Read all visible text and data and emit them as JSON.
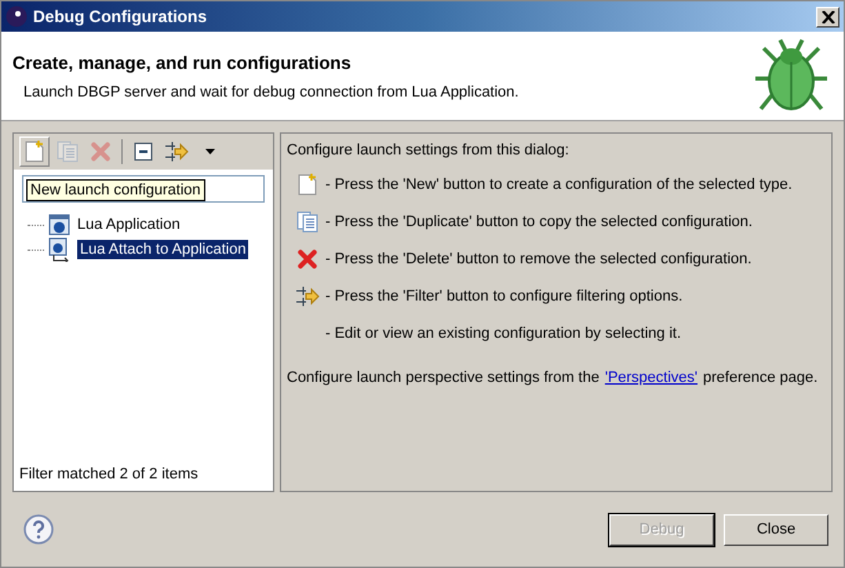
{
  "window": {
    "title": "Debug Configurations"
  },
  "header": {
    "title": "Create, manage, and run configurations",
    "message": "Launch DBGP server and wait for debug connection from Lua Application."
  },
  "toolbar": [
    {
      "kind": "new",
      "disabled": false
    },
    {
      "kind": "duplicate",
      "disabled": true
    },
    {
      "kind": "delete",
      "disabled": true
    },
    {
      "kind": "collapse",
      "disabled": false
    },
    {
      "kind": "filter",
      "disabled": false
    },
    {
      "kind": "menu",
      "disabled": false
    }
  ],
  "tooltip": "New launch configuration",
  "tree": [
    {
      "label": "Lua Application",
      "kind": "app",
      "selected": false
    },
    {
      "label": "Lua Attach to Application",
      "kind": "attach",
      "selected": true
    }
  ],
  "filter_status": "Filter matched 2 of 2 items",
  "info": {
    "intro": "Configure launch settings from this dialog:",
    "items": [
      {
        "kind": "new",
        "text": "- Press the 'New' button to create a configuration of the selected type."
      },
      {
        "kind": "duplicate",
        "text": "- Press the 'Duplicate' button to copy the selected configuration."
      },
      {
        "kind": "delete",
        "text": "- Press the 'Delete' button to remove the selected configuration."
      },
      {
        "kind": "filter",
        "text": "- Press the 'Filter' button to configure filtering options."
      },
      {
        "kind": "none",
        "text": "- Edit or view an existing configuration by selecting it."
      }
    ],
    "footer_before": "Configure launch perspective settings from the",
    "footer_link": "'Perspectives'",
    "footer_after": "preference page."
  },
  "buttons": [
    {
      "label": "Debug",
      "disabled": true,
      "default": true
    },
    {
      "label": "Close",
      "disabled": false,
      "default": false
    }
  ]
}
